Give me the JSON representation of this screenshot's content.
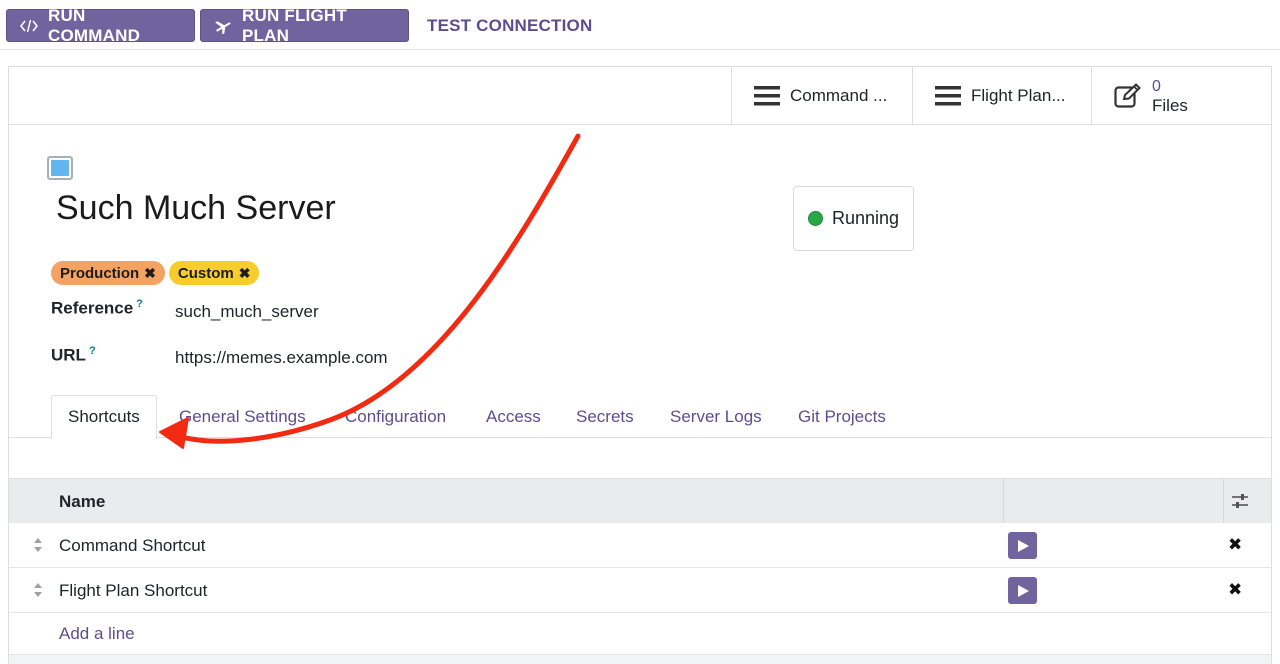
{
  "toolbar": {
    "run_command_label": "RUN COMMAND",
    "run_flight_plan_label": "RUN FLIGHT PLAN",
    "test_connection_label": "TEST CONNECTION"
  },
  "stat_buttons": {
    "command_label": "Command ...",
    "flight_plan_label": "Flight Plan...",
    "files_count": "0",
    "files_label": "Files"
  },
  "record": {
    "name": "Such Much Server",
    "color": "#62b6ef",
    "status": "Running",
    "status_color": "#28a745",
    "tags": [
      {
        "label": "Production",
        "color": "#f4a261"
      },
      {
        "label": "Custom",
        "color": "#f7cd2e"
      }
    ],
    "reference_label": "Reference",
    "reference_value": "such_much_server",
    "url_label": "URL",
    "url_value": "https://memes.example.com",
    "help_marker": "?"
  },
  "tabs": [
    {
      "label": "Shortcuts",
      "active": true
    },
    {
      "label": "General Settings",
      "active": false
    },
    {
      "label": "Configuration",
      "active": false
    },
    {
      "label": "Access",
      "active": false
    },
    {
      "label": "Secrets",
      "active": false
    },
    {
      "label": "Server Logs",
      "active": false
    },
    {
      "label": "Git Projects",
      "active": false
    }
  ],
  "shortcuts_table": {
    "column_name": "Name",
    "rows": [
      {
        "name": "Command Shortcut"
      },
      {
        "name": "Flight Plan Shortcut"
      }
    ],
    "add_line_label": "Add a line",
    "delete_glyph": "✖"
  },
  "icons": {
    "run_command": "code-icon",
    "run_flight_plan": "plane-icon",
    "command_stat": "bars-icon",
    "flight_plan_stat": "bars-icon",
    "files_stat": "edit-icon",
    "optional_columns": "sliders-icon",
    "play": "play-icon",
    "drag_handle": "sort-handle-icon",
    "delete": "close-icon"
  },
  "accent_color": "#71639e",
  "annotation_color": "#f22a12"
}
